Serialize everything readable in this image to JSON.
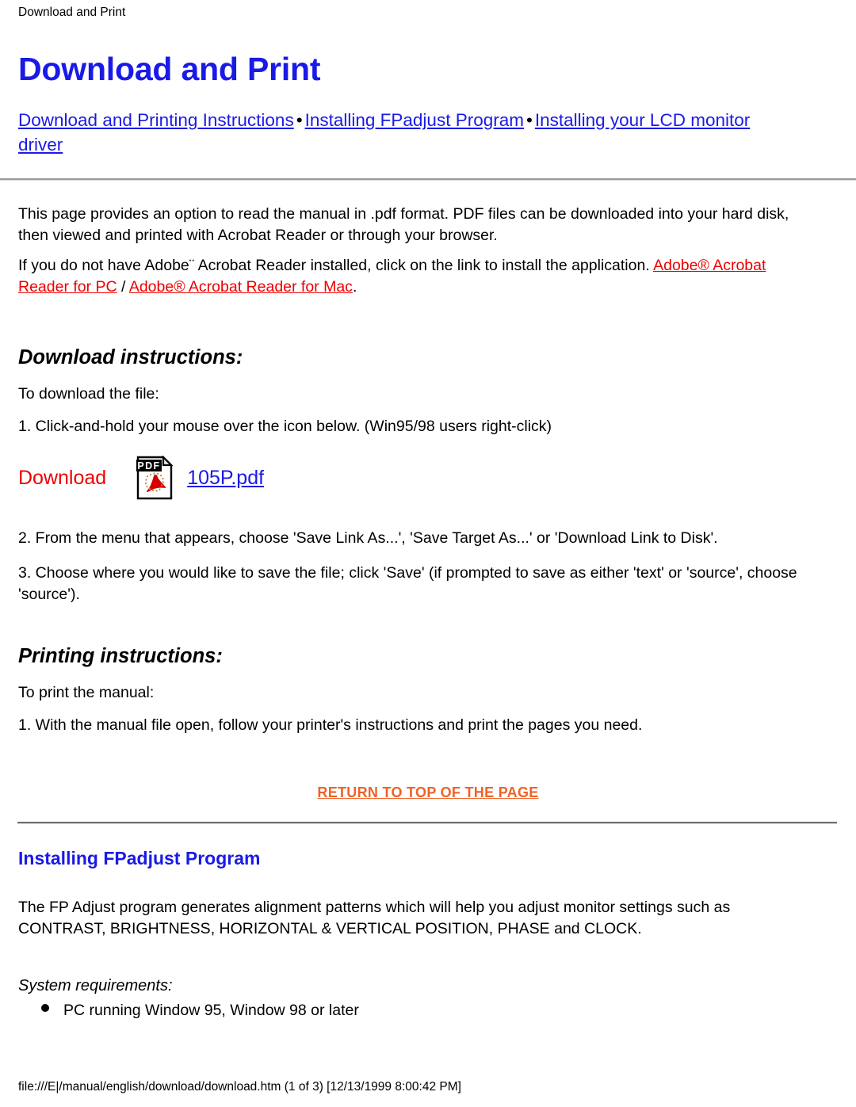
{
  "document": {
    "running_header": "Download and Print",
    "title": "Download and Print"
  },
  "nav": {
    "separator": "•",
    "links": [
      {
        "label": "Download and Printing Instructions"
      },
      {
        "label": "Installing FPadjust Program"
      },
      {
        "label": "Installing your LCD monitor driver"
      }
    ]
  },
  "intro": {
    "paragraph_1": "This page provides an option to read the manual in .pdf format. PDF files can be downloaded into your hard disk, then viewed and printed with Acrobat Reader or through your browser.",
    "paragraph_2_before": "If you do not have Adobe¨ Acrobat Reader installed, click on the link to install the application. ",
    "link_pc": "Adobe® Acrobat Reader for PC",
    "paragraph_2_divider": " / ",
    "link_mac": "Adobe® Acrobat Reader for Mac",
    "paragraph_2_after": "."
  },
  "download_section": {
    "heading": "Download instructions:",
    "lead": "To download the file:",
    "step_1": "1. Click-and-hold your mouse over the icon below. (Win95/98 users right-click)",
    "download_label": "Download",
    "pdf_icon_name": "pdf-file-icon",
    "pdf_icon_text": "PDF",
    "pdf_filename": "105P.pdf",
    "step_2": "2. From the menu that appears, choose 'Save Link As...', 'Save Target As...' or 'Download Link to Disk'.",
    "step_3": "3. Choose where you would like to save the file; click 'Save' (if prompted to save as either 'text' or 'source', choose 'source')."
  },
  "printing_section": {
    "heading": "Printing instructions:",
    "lead": "To print the manual:",
    "step_1": "1. With the manual file open, follow your printer's instructions and print the pages you need."
  },
  "return_to_top": {
    "label": "RETURN TO TOP OF THE PAGE"
  },
  "fpadjust_section": {
    "heading": "Installing FPadjust Program",
    "paragraph": "The FP Adjust program generates alignment patterns which will help you adjust monitor settings such as CONTRAST, BRIGHTNESS, HORIZONTAL & VERTICAL POSITION, PHASE and CLOCK.",
    "requirements_label": "System requirements:",
    "requirements": [
      "PC running Window 95, Window 98 or later"
    ]
  },
  "footer": {
    "path_status": "file:///E|/manual/english/download/download.htm (1 of 3) [12/13/1999 8:00:42 PM]"
  },
  "colors": {
    "link_blue": "#1a1ae6",
    "link_red": "#ee0000",
    "link_orange": "#ef6227",
    "rule_gray": "#9a9a9a",
    "text_black": "#000000"
  }
}
